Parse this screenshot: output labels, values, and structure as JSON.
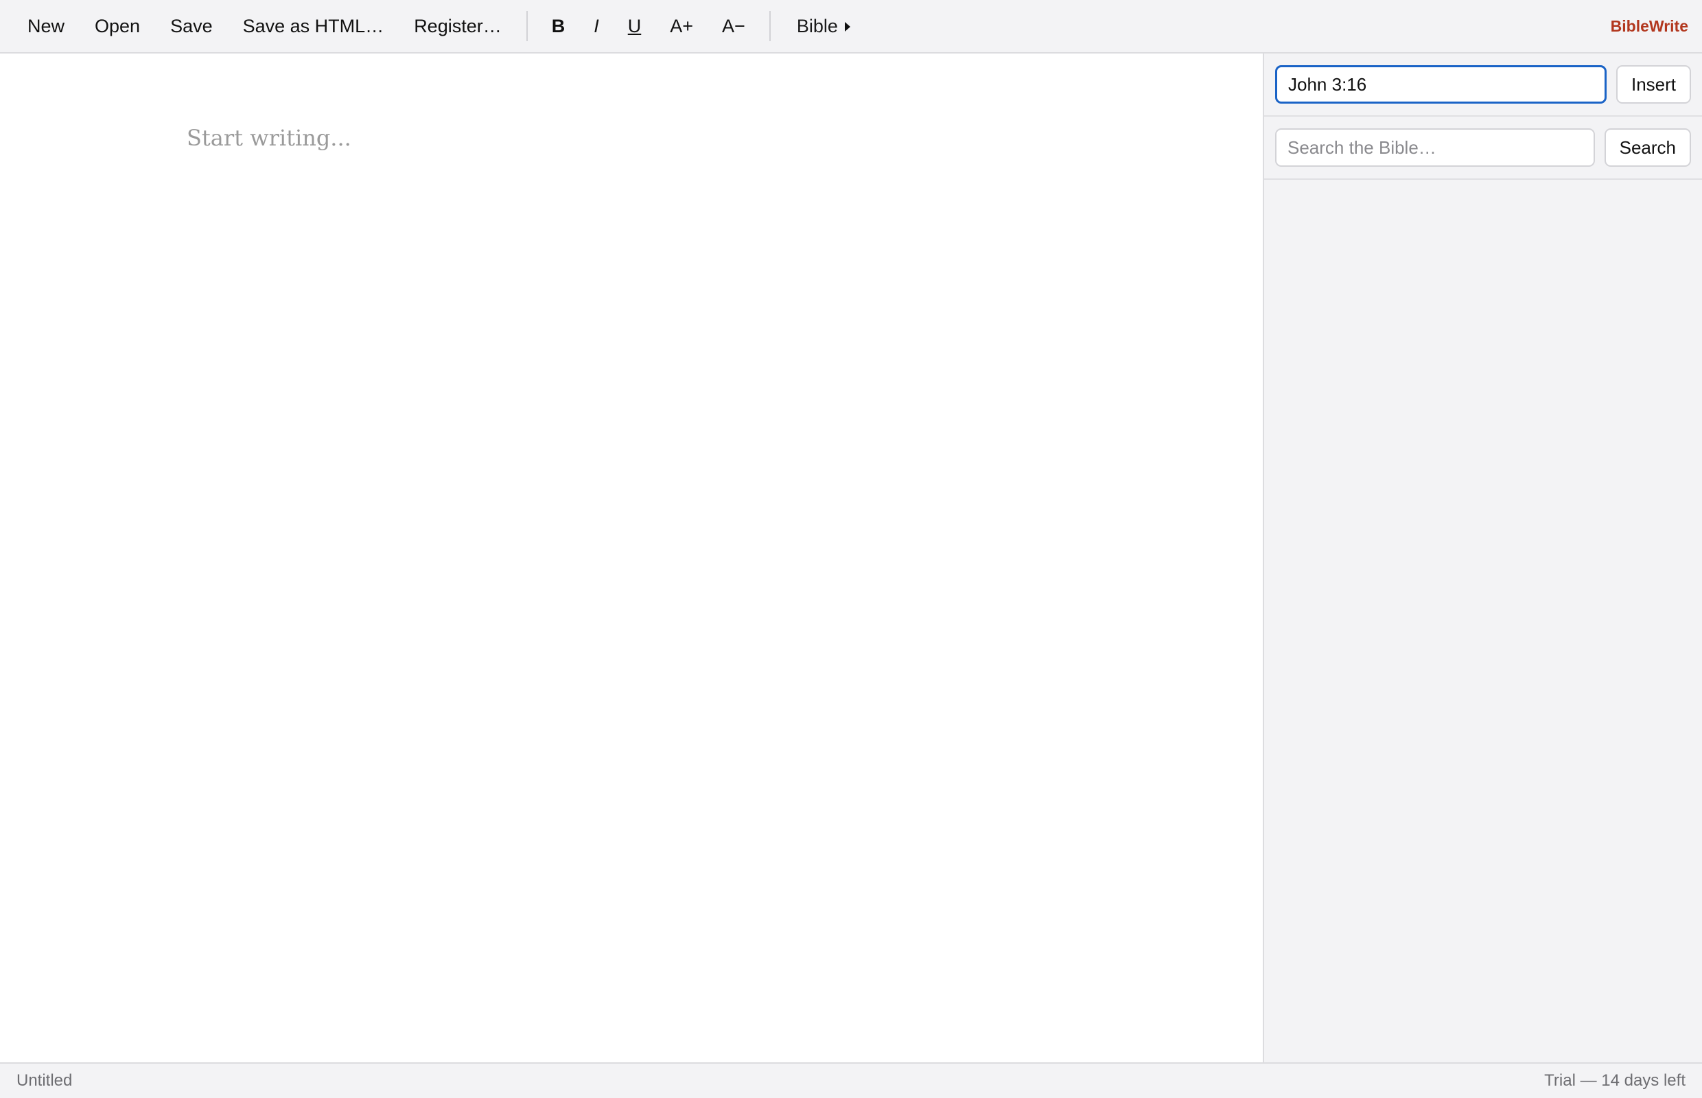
{
  "toolbar": {
    "file_buttons": [
      {
        "name": "new-button",
        "label": "New"
      },
      {
        "name": "open-button",
        "label": "Open"
      },
      {
        "name": "save-button",
        "label": "Save"
      },
      {
        "name": "save-as-html-button",
        "label": "Save as HTML…"
      },
      {
        "name": "register-button",
        "label": "Register…"
      }
    ],
    "format_buttons": {
      "bold": "B",
      "italic": "I",
      "underline": "U",
      "increase_font": "A+",
      "decrease_font": "A−"
    },
    "bible_menu": {
      "label": "Bible",
      "icon": "caret-right-icon"
    },
    "brand": "BibleWrite",
    "brand_color": "#b2371e"
  },
  "editor": {
    "placeholder": "Start writing..."
  },
  "sidebar": {
    "reference": {
      "value": "John 3:16",
      "insert_label": "Insert"
    },
    "search": {
      "placeholder": "Search the Bible…",
      "value": "",
      "search_label": "Search"
    },
    "focus_color": "#1a63c6"
  },
  "status": {
    "document_name": "Untitled",
    "trial": "Trial — 14 days left"
  }
}
